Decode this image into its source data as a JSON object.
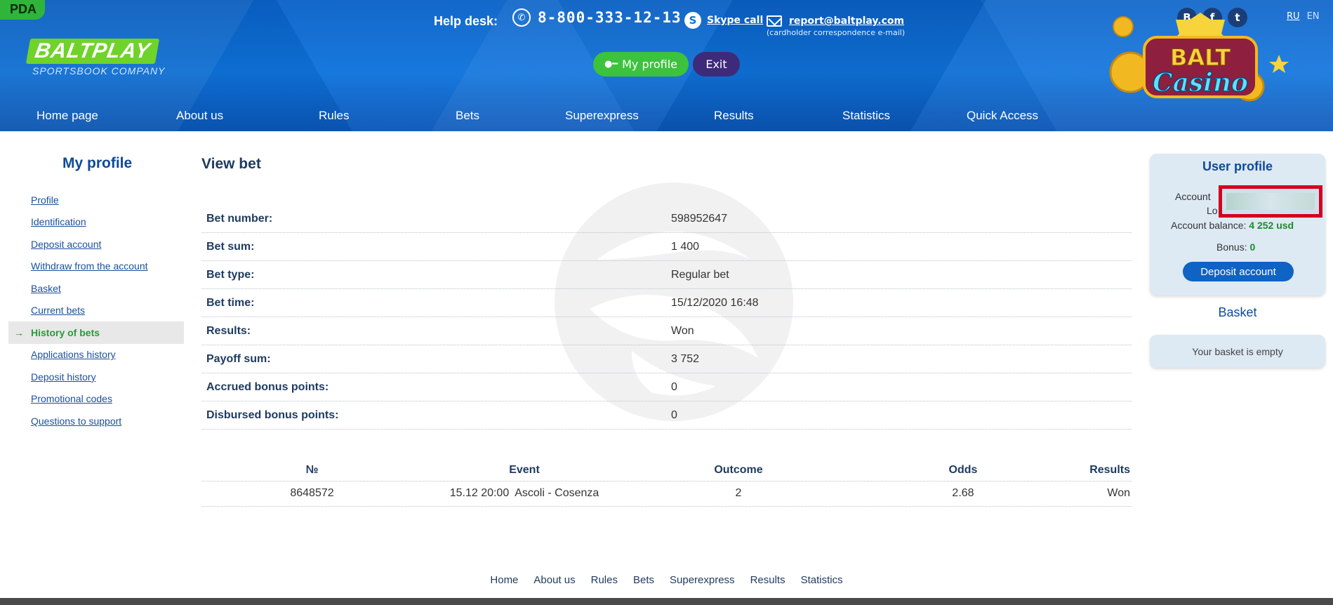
{
  "header": {
    "pda": "PDA",
    "logo_main": "BALTPLAY",
    "logo_sub": "SPORTSBOOK COMPANY",
    "helpdesk_label": "Help desk:",
    "phone": "8-800-333-12-13",
    "skype_label": "Skype call",
    "email": "report@baltplay.com",
    "email_note": "(cardholder correspondence e-mail)",
    "my_profile_label": "My profile",
    "exit_label": "Exit",
    "social": [
      "B",
      "f",
      "t"
    ],
    "lang": [
      "RU",
      "EN"
    ],
    "casino_line1": "BALT",
    "casino_line2": "Casino"
  },
  "nav": [
    "Home page",
    "About us",
    "Rules",
    "Bets",
    "Superexpress",
    "Results",
    "Statistics",
    "Quick Access"
  ],
  "sidebar": {
    "title": "My profile",
    "items": [
      "Profile",
      "Identification",
      "Deposit account",
      "Withdraw from the account",
      "Basket",
      "Current bets",
      "History of bets",
      "Applications history",
      "Deposit history",
      "Promotional codes",
      "Questions to support"
    ],
    "active_index": 6
  },
  "main": {
    "title": "View bet",
    "details": [
      {
        "label": "Bet number:",
        "value": "598952647"
      },
      {
        "label": "Bet sum:",
        "value": "1 400"
      },
      {
        "label": "Bet type:",
        "value": "Regular bet"
      },
      {
        "label": "Bet time:",
        "value": "15/12/2020 16:48"
      },
      {
        "label": "Results:",
        "value": "Won"
      },
      {
        "label": "Payoff sum:",
        "value": "3 752"
      },
      {
        "label": "Accrued bonus points:",
        "value": "0"
      },
      {
        "label": "Disbursed bonus points:",
        "value": "0"
      }
    ],
    "events_headers": [
      "№",
      "Event",
      "Outcome",
      "Odds",
      "Results"
    ],
    "events": [
      {
        "num": "8648572",
        "event": "15.12 20:00  Ascoli - Cosenza",
        "outcome": "2",
        "odds": "2.68",
        "result": "Won"
      }
    ]
  },
  "user_profile": {
    "title": "User profile",
    "account_label": "Account",
    "login_label": "Lo",
    "balance_label": "Account balance:",
    "balance_value": "4 252 usd",
    "bonus_label": "Bonus:",
    "bonus_value": "0",
    "deposit_label": "Deposit account"
  },
  "basket": {
    "title": "Basket",
    "empty_text": "Your basket is empty"
  },
  "footer": [
    "Home",
    "About us",
    "Rules",
    "Bets",
    "Superexpress",
    "Results",
    "Statistics"
  ],
  "colors": {
    "header_blue": "#0e73dc",
    "green": "#3cc23d",
    "purple": "#3e2a7a",
    "active_green": "#2a9a3a"
  }
}
